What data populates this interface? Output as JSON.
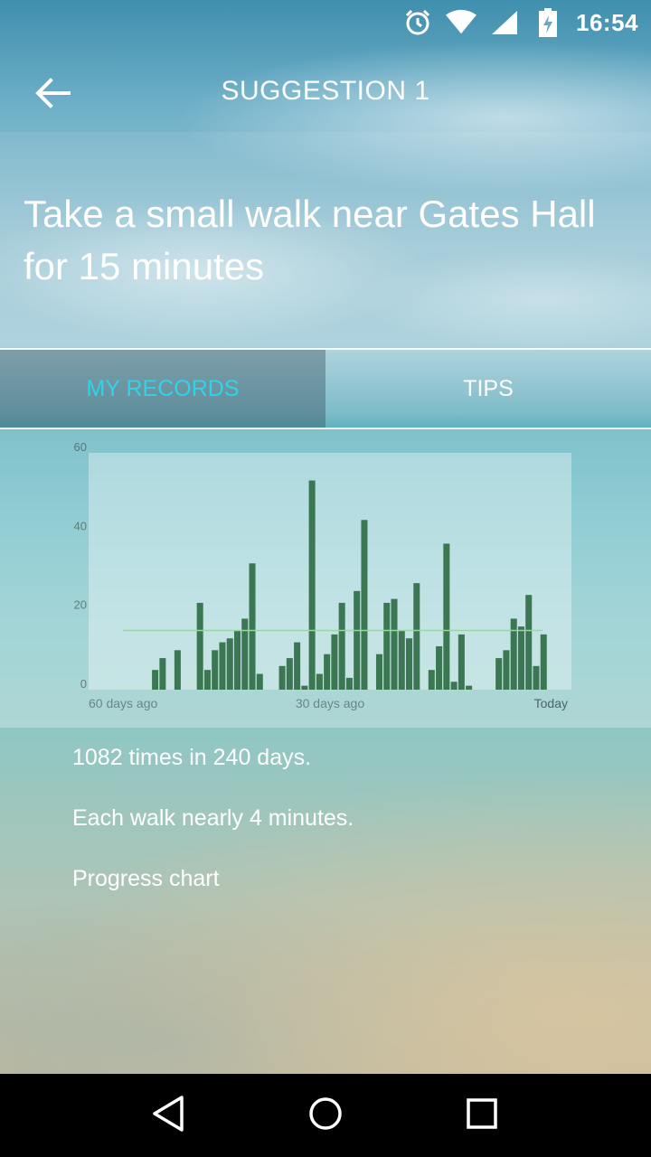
{
  "status_bar": {
    "time": "16:54",
    "icons": [
      "alarm-icon",
      "wifi-icon",
      "signal-icon",
      "battery-charging-icon"
    ]
  },
  "app_bar": {
    "title": "SUGGESTION 1",
    "back_icon": "arrow-back-icon"
  },
  "headline": {
    "line1": "Take a small walk near Gates Hall",
    "line2": "for 15 minutes"
  },
  "tabs": [
    {
      "label": "MY RECORDS",
      "active": true
    },
    {
      "label": "TIPS",
      "active": false
    }
  ],
  "colors": {
    "active_tab": "#2fd3ea",
    "bar": "#2f6e45",
    "average_line": "#8ee38a"
  },
  "chart_data": {
    "type": "bar",
    "ylim": [
      0,
      60
    ],
    "yticks": [
      "0",
      "20",
      "40",
      "60"
    ],
    "x_labels": [
      "60 days ago",
      "30 days ago",
      "Today"
    ],
    "series": [
      {
        "values": [
          0,
          0,
          0,
          0,
          0,
          0,
          0,
          0,
          5,
          8,
          0,
          10,
          0,
          0,
          22,
          5,
          10,
          12,
          13,
          15,
          18,
          32,
          4,
          0,
          0,
          6,
          8,
          12,
          1,
          53,
          4,
          9,
          14,
          22,
          3,
          25,
          43,
          0,
          9,
          22,
          23,
          15,
          13,
          27,
          0,
          5,
          11,
          37,
          2,
          14,
          1,
          0,
          0,
          0,
          8,
          10,
          18,
          16,
          24,
          6,
          14
        ]
      }
    ],
    "average": 15
  },
  "stats": {
    "times": "1082 times in 240 days.",
    "duration": "Each walk nearly 4 minutes.",
    "progress": "Progress chart"
  },
  "nav_bar": {
    "icons": [
      "back-triangle-icon",
      "home-circle-icon",
      "recents-square-icon"
    ]
  }
}
